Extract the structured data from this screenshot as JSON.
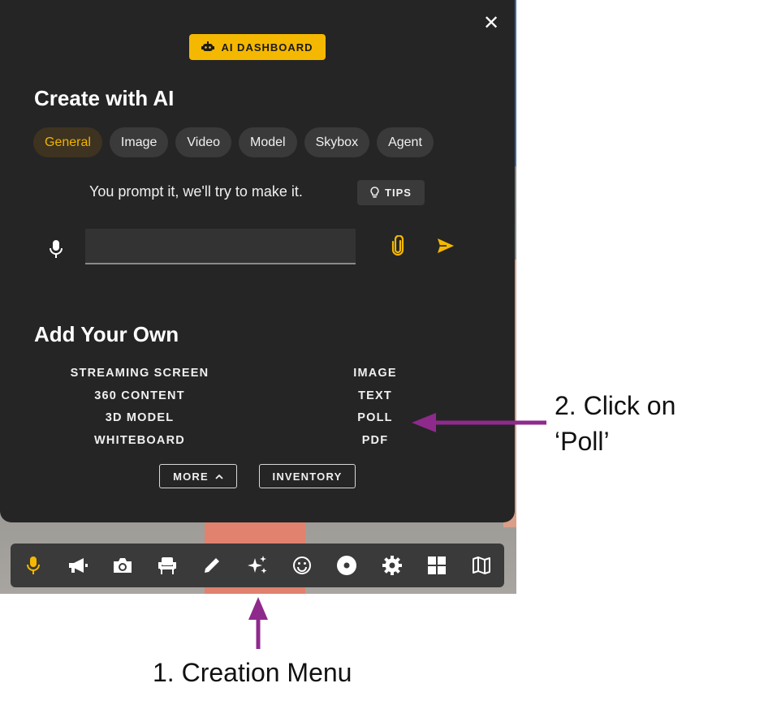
{
  "colors": {
    "panel_bg": "#252525",
    "accent": "#f5b800",
    "annotation_arrow": "#8e2a8c",
    "toolbar_bg": "#3a3a3a"
  },
  "header": {
    "ai_dashboard_label": "AI DASHBOARD",
    "ai_dashboard_icon": "robot-icon",
    "close_icon": "close-icon"
  },
  "create": {
    "title": "Create with AI",
    "tabs": [
      {
        "label": "General",
        "active": true
      },
      {
        "label": "Image",
        "active": false
      },
      {
        "label": "Video",
        "active": false
      },
      {
        "label": "Model",
        "active": false
      },
      {
        "label": "Skybox",
        "active": false
      },
      {
        "label": "Agent",
        "active": false
      }
    ],
    "prompt_hint": "You prompt it, we'll try to make it.",
    "tips_label": "TIPS",
    "prompt_value": ""
  },
  "own": {
    "title": "Add Your Own",
    "left_items": [
      "STREAMING SCREEN",
      "360 CONTENT",
      "3D MODEL",
      "WHITEBOARD"
    ],
    "right_items": [
      "IMAGE",
      "TEXT",
      "POLL",
      "PDF"
    ],
    "more_label": "MORE",
    "inventory_label": "INVENTORY"
  },
  "toolbar": {
    "icons": [
      "microphone-icon",
      "megaphone-icon",
      "camera-icon",
      "seat-icon",
      "pencil-icon",
      "sparkles-icon",
      "smiley-icon",
      "disc-icon",
      "gear-icon",
      "grid-icon",
      "map-icon"
    ],
    "active_icon": "microphone-icon"
  },
  "annotations": {
    "step2_line1": "2. Click on",
    "step2_line2": "‘Poll’",
    "step1": "1. Creation Menu"
  }
}
